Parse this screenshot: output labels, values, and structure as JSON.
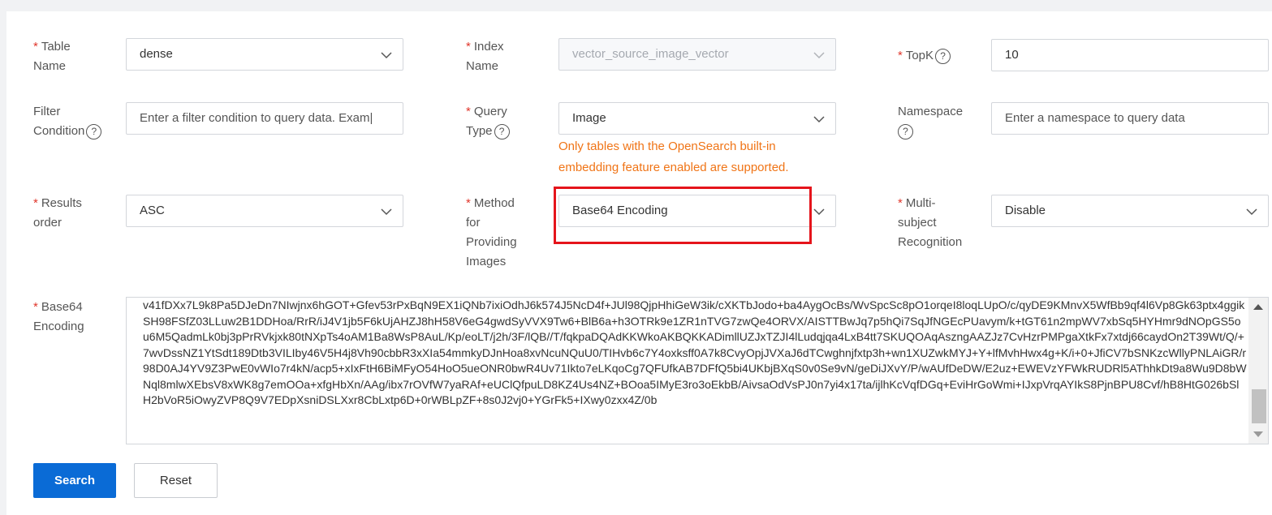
{
  "form": {
    "table_name": {
      "required": "*",
      "label_line1": "Table",
      "label_line2": "Name",
      "value": "dense"
    },
    "index_name": {
      "required": "*",
      "label_line1": "Index",
      "label_line2": "Name",
      "value": "vector_source_image_vector"
    },
    "topk": {
      "required": "*",
      "label": "TopK",
      "value": "10"
    },
    "filter_condition": {
      "label_line1": "Filter",
      "label_line2": "Condition",
      "placeholder": "Enter a filter condition to query data. Exam|"
    },
    "query_type": {
      "required": "*",
      "label_line1": "Query",
      "label_line2": "Type",
      "value": "Image",
      "hint_line1": "Only tables with the OpenSearch built-in",
      "hint_line2": "embedding feature enabled are supported."
    },
    "namespace": {
      "label_line1": "Namespace",
      "placeholder": "Enter a namespace to query data"
    },
    "results_order": {
      "required": "*",
      "label_line1": "Results",
      "label_line2": "order",
      "value": "ASC"
    },
    "method": {
      "required": "*",
      "label_line1": "Method",
      "label_line2": "for",
      "label_line3": "Providing",
      "label_line4": "Images",
      "value": "Base64 Encoding"
    },
    "multi_subject": {
      "required": "*",
      "label_line1": "Multi-",
      "label_line2": "subject",
      "label_line3": "Recognition",
      "value": "Disable"
    },
    "base64": {
      "required": "*",
      "label_line1": "Base64",
      "label_line2": "Encoding",
      "value": "v41fDXx7L9k8Pa5DJeDn7NIwjnx6hGOT+Gfev53rPxBqN9EX1iQNb7ixiOdhJ6k574J5NcD4f+JUl98QjpHhiGeW3ik/cXKTbJodo+ba4AygOcBs/WvSpcSc8pO1orqeI8loqLUpO/c/qyDE9KMnvX5WfBb9qf4l6Vp8Gk63ptx4ggikSH98FSfZ03LLuw2B1DDHoa/RrR/iJ4V1jb5F6kUjAHZJ8hH58V6eG4gwdSyVVX9Tw6+BlB6a+h3OTRk9e1ZR1nTVG7zwQe4ORVX/AISTTBwJq7p5hQi7SqJfNGEcPUavym/k+tGT61n2mpWV7xbSq5HYHmr9dNOpGS5ou6M5QadmLk0bj3pPrRVkjxk80tNXpTs4oAM1Ba8WsP8AuL/Kp/eoLT/j2h/3F/lQB//T/fqkpaDQAdKKWkoAKBQKKADimllUZJxTZJI4lLudqjqa4LxB4tt7SKUQOAqAszngAAZJz7CvHzrPMPgaXtkFx7xtdj66caydOn2T39Wt/Q/+7wvDssNZ1YtSdt189Dtb3VILIby46V5H4j8Vh90cbbR3xXIa54mmkyDJnHoa8xvNcuNQuU0/TIHvb6c7Y4oxksff0A7k8CvyOpjJVXaJ6dTCwghnjfxtp3h+wn1XUZwkMYJ+Y+lfMvhHwx4g+K/i+0+JfiCV7bSNKzcWllyPNLAiGR/r98D0AJ4YV9Z3PwE0vWIo7r4kN/acp5+xIxFtH6BiMFyO54HoO5ueONR0bwR4Uv71Ikto7eLKqoCg7QFUfkAB7DFfQ5bi4UKbjBXqS0v0Se9vN/geDiJXvY/P/wAUfDeDW/E2uz+EWEVzYFWkRUDRl5AThhkDt9a8Wu9D8bWNql8mlwXEbsV8xWK8g7emOOa+xfgHbXn/AAg/ibx7rOVfW7yaRAf+eUClQfpuLD8KZ4Us4NZ+BOoa5IMyE3ro3oEkbB/AivsaOdVsPJ0n7yi4x17ta/ijlhKcVqfDGq+EviHrGoWmi+IJxpVrqAYIkS8PjnBPU8Cvf/hB8HtG026bSlH2bVoR5iOwyZVP8Q9V7EDpXsniDSLXxr8CbLxtp6D+0rWBLpZF+8s0J2vj0+YGrFk5+IXwy0zxx4Z/0b"
    }
  },
  "buttons": {
    "search": "Search",
    "reset": "Reset"
  },
  "icons": {
    "help": "question-circle-icon",
    "dropdown": "chevron-down-icon"
  },
  "colors": {
    "primary": "#0a6bd6",
    "required": "#e0372c",
    "hint": "#f07416",
    "highlight": "#e5141b"
  }
}
